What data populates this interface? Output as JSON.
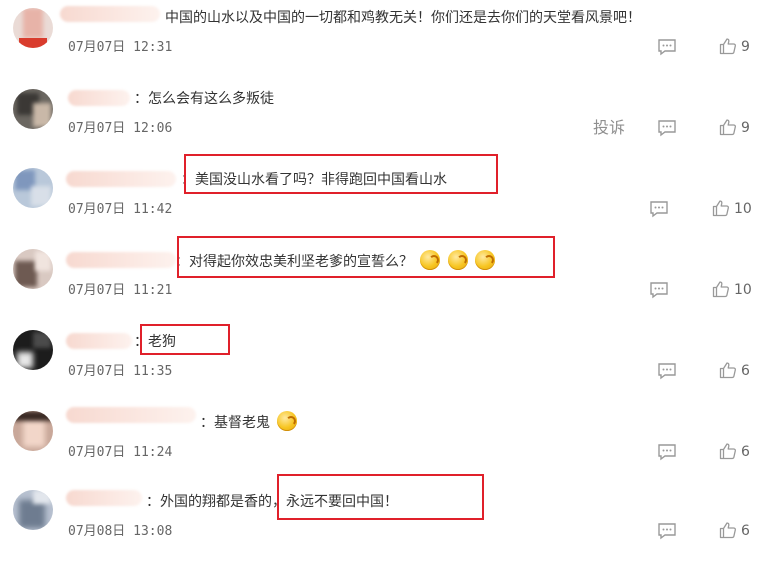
{
  "comments": [
    {
      "text": "中国的山水以及中国的一切都和鸡教无关！你们还是去你们的天堂看风景吧！",
      "time": "07月07日 12:31",
      "likes": "9",
      "report": null
    },
    {
      "text": "：怎么会有这么多叛徒",
      "time": "07月07日 12:06",
      "likes": "9",
      "report": "投诉"
    },
    {
      "text": "：美国没山水看了吗？非得跑回中国看山水",
      "time": "07月07日 11:42",
      "likes": "10",
      "report": null
    },
    {
      "text": "：对得起你效忠美利坚老爹的宣誓么？",
      "time": "07月07日 11:21",
      "likes": "10",
      "report": null,
      "emojis": [
        "face-emoji-icon",
        "face-emoji-icon",
        "face-emoji-icon"
      ]
    },
    {
      "text": "：老狗",
      "time": "07月07日 11:35",
      "likes": "6",
      "report": null
    },
    {
      "text": "：基督老鬼",
      "time": "07月07日 11:24",
      "likes": "6",
      "report": null,
      "emojis": [
        "crying-laughing-emoji-icon"
      ]
    },
    {
      "text": "：外国的翔都是香的，永远不要回中国！",
      "time": "07月08日 13:08",
      "likes": "6",
      "report": null
    }
  ],
  "colors": {
    "highlight_border": "#e0202a",
    "text": "#333333",
    "muted": "#666666",
    "icon": "#999999"
  }
}
